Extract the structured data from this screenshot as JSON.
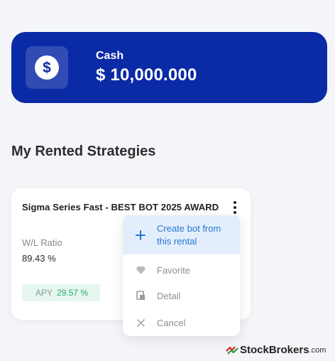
{
  "cash": {
    "label": "Cash",
    "value": "$ 10,000.000",
    "icon": "dollar-circle-icon",
    "background": "#0a2aa6"
  },
  "section": {
    "title": "My Rented Strategies"
  },
  "strategy": {
    "name": "Sigma Series Fast - BEST BOT 2025 AWARD",
    "wl_label": "W/L Ratio",
    "wl_value": "89.43 %",
    "apy_label": "APY",
    "apy_value": "29.57 %",
    "apy_color": "#1fae73"
  },
  "menu": {
    "items": [
      {
        "label": "Create bot from this rental",
        "icon": "plus-icon",
        "active": true
      },
      {
        "label": "Favorite",
        "icon": "heart-icon"
      },
      {
        "label": "Detail",
        "icon": "detail-icon"
      },
      {
        "label": "Cancel",
        "icon": "close-icon"
      }
    ],
    "accent": "#2476d4"
  },
  "watermark": {
    "brand": "StockBrokers",
    "suffix": ".com"
  }
}
